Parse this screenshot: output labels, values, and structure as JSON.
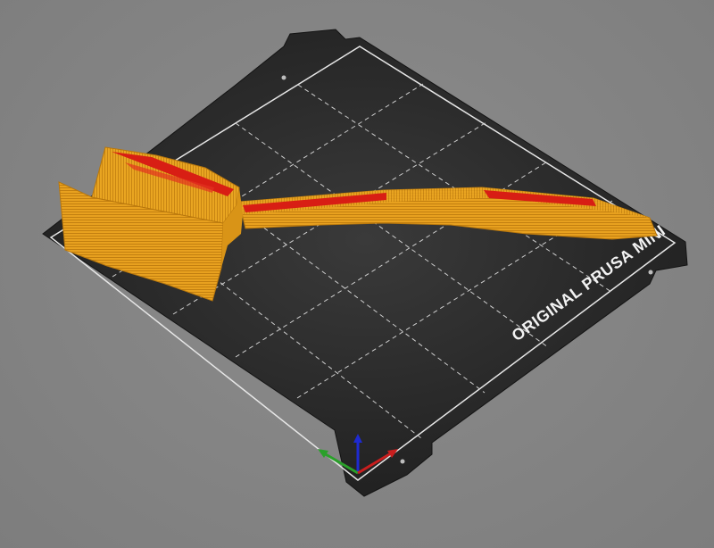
{
  "viewport": {
    "name": "3D print preview",
    "background_color": "#808080"
  },
  "bed": {
    "label": "ORIGINAL PRUSA MINI",
    "color": "#262626",
    "grid_color": "#cfcfcf",
    "border_color": "#e6e6e6"
  },
  "model": {
    "filament_color": "#e8a11f",
    "infill_color": "#d81e14",
    "icon": "3d-printed-part"
  },
  "axes": {
    "x_color": "#c81e1e",
    "y_color": "#2aa02a",
    "z_color": "#1e2ad0",
    "icon": "axes-gizmo-icon"
  }
}
